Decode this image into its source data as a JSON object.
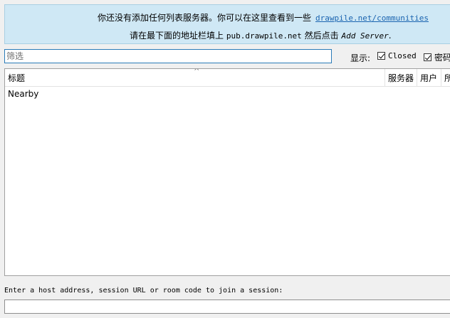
{
  "info": {
    "line1_text": "你还没有添加任何列表服务器。你可以在这里查看到一些",
    "line1_link": "drawpile.net/communities",
    "line2_prefix": "请在最下面的地址栏填上",
    "line2_host": "pub.drawpile.net",
    "line2_middle": "然后点击",
    "line2_action": "Add Server",
    "line2_suffix": "."
  },
  "filter": {
    "placeholder": "筛选",
    "value": ""
  },
  "show": {
    "label": "显示:",
    "closed_label": "Closed",
    "closed_checked": true,
    "password_label": "密码",
    "password_checked": true
  },
  "table": {
    "columns": [
      "标题",
      "服务器",
      "用户",
      "所"
    ],
    "rows": [
      {
        "title": "Nearby"
      }
    ]
  },
  "join": {
    "label": "Enter a host address, session URL or room code to join a session:",
    "value": ""
  }
}
